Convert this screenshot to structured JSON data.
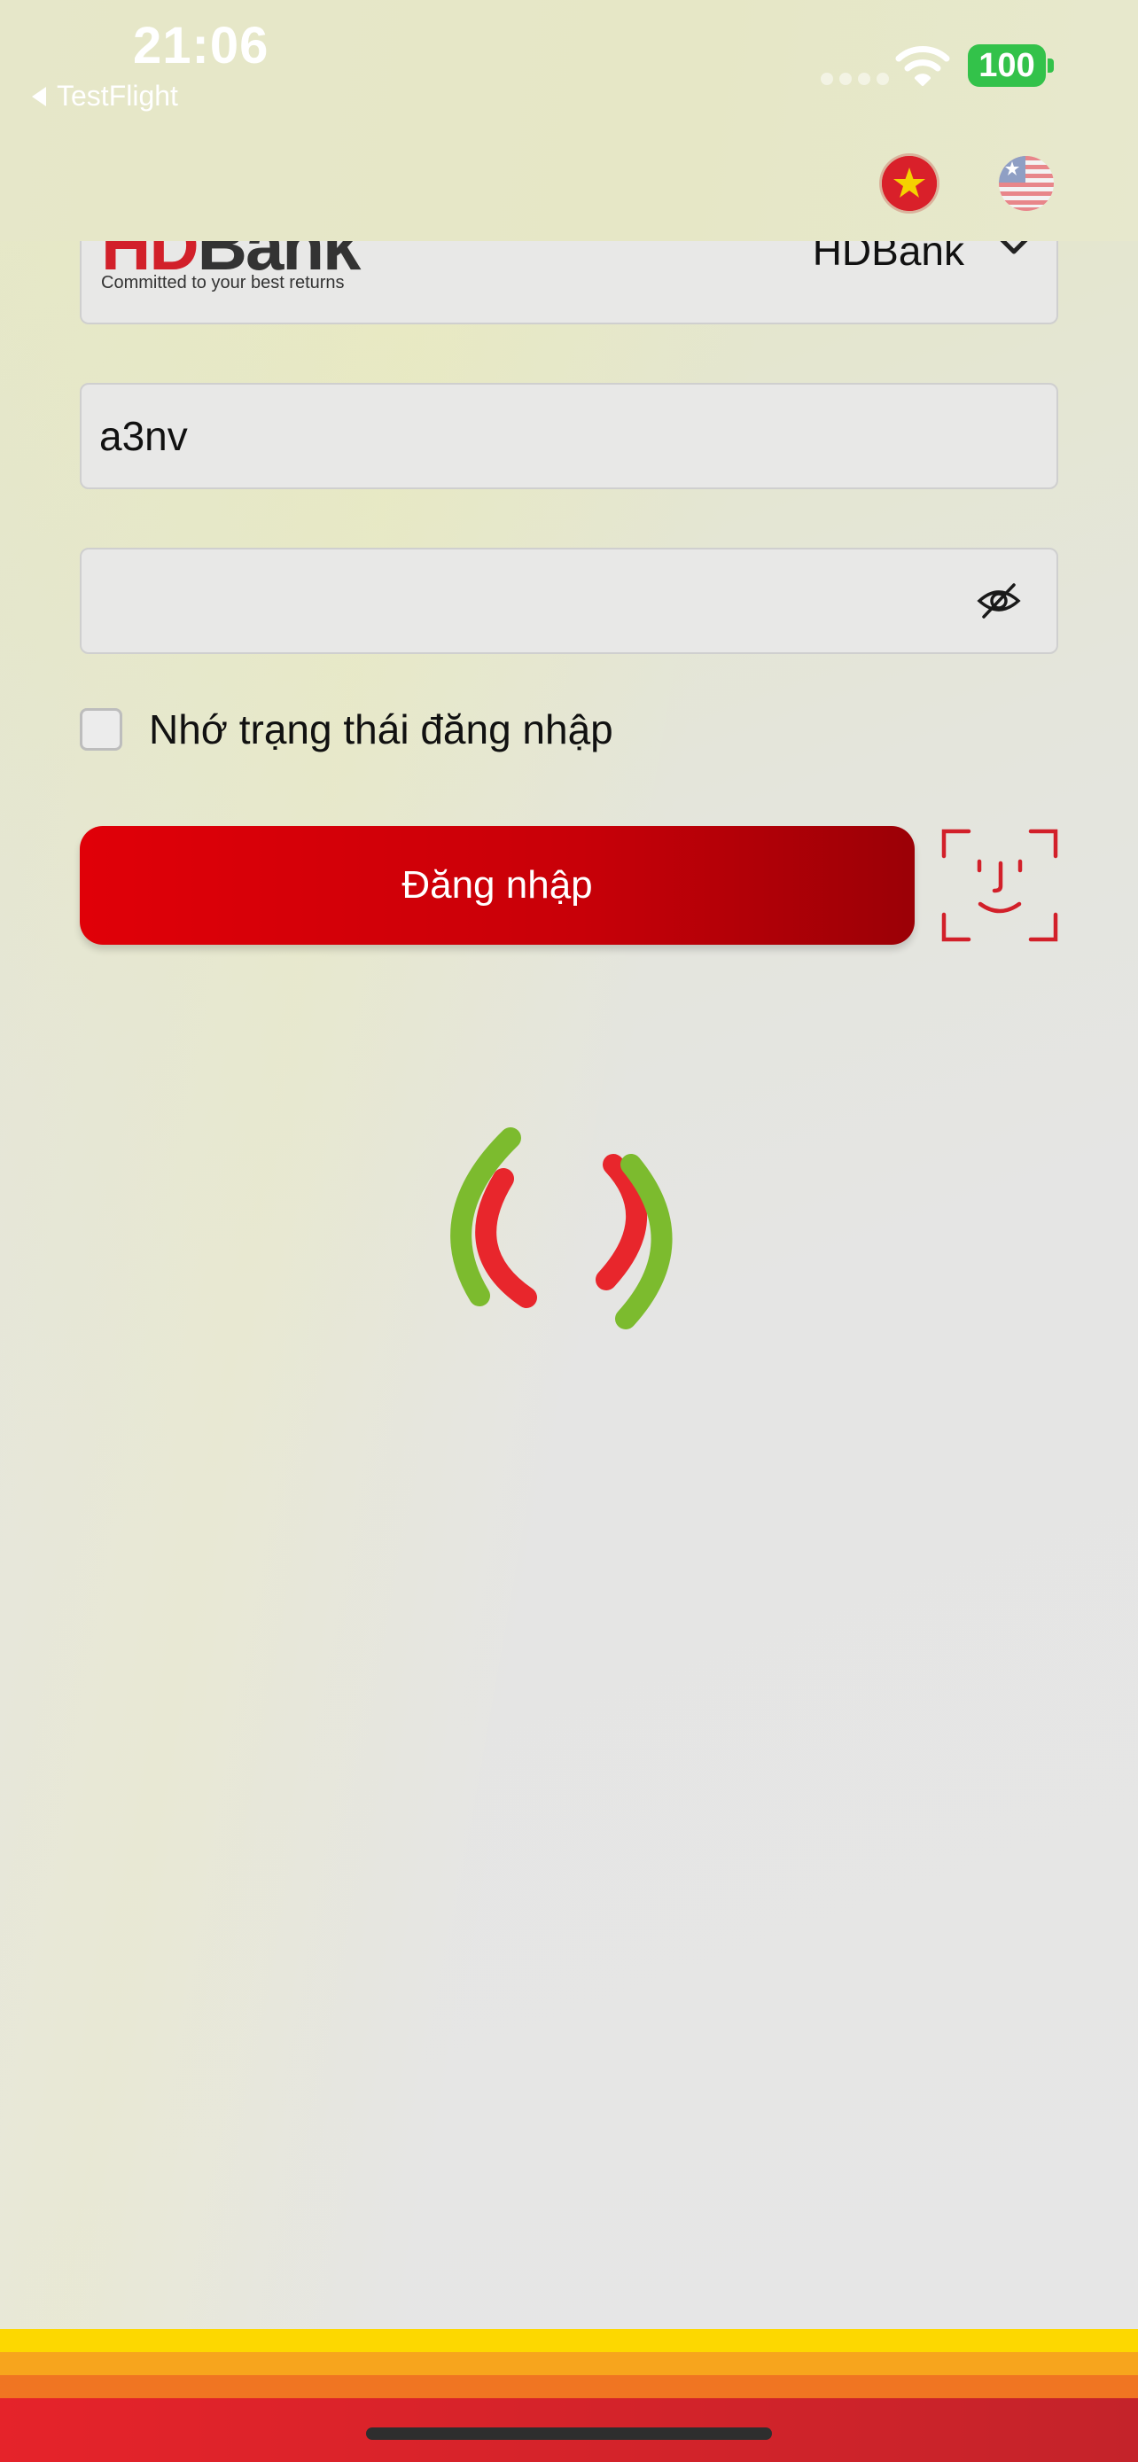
{
  "status_bar": {
    "time": "21:06",
    "back_label": "TestFlight",
    "battery": "100"
  },
  "language": {
    "options": [
      "vietnamese-flag",
      "us-flag"
    ]
  },
  "bank_select": {
    "logo_text_hd": "HD",
    "logo_text_bank": "Bank",
    "slogan": "Committed to your best returns",
    "selected": "HDBank"
  },
  "login_form": {
    "username_value": "a3nv",
    "password_value": "",
    "remember_label": "Nhớ trạng thái đăng nhập",
    "remember_checked": false,
    "login_button": "Đăng nhập"
  },
  "colors": {
    "brand_red": "#d2202a",
    "button_red": "#e00008",
    "spinner_green": "#7cbb2e",
    "spinner_red": "#e8262c",
    "stripe_yellow": "#fdd800",
    "stripe_orange": "#f7a51d",
    "stripe_dark_orange": "#f07522",
    "stripe_red": "#e5232a"
  },
  "icons": [
    "back-caret-icon",
    "wifi-icon",
    "eye-slash-icon",
    "face-id-icon",
    "chevron-down-icon",
    "loading-spinner-icon"
  ]
}
